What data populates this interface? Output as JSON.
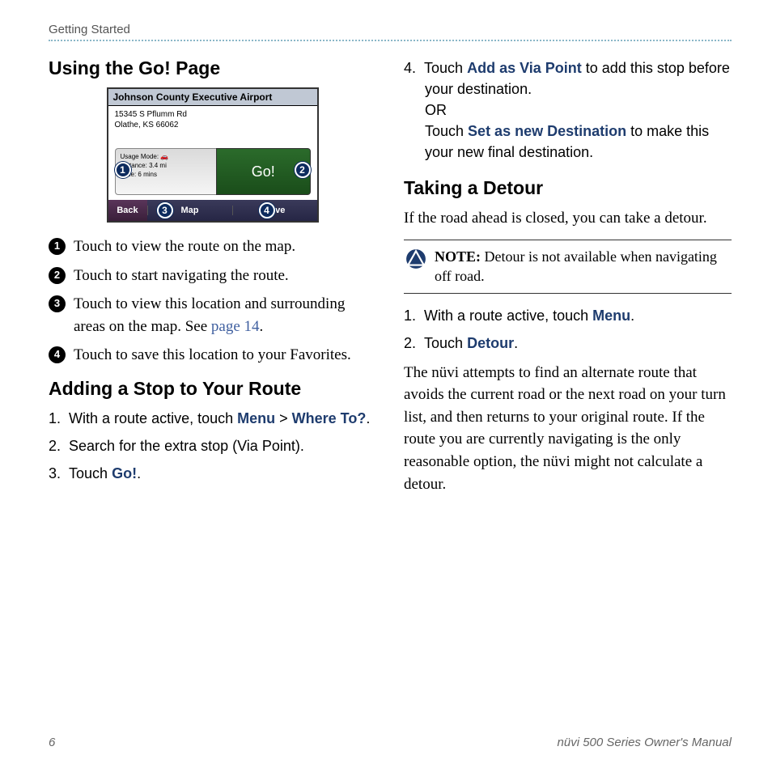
{
  "header": {
    "section": "Getting Started"
  },
  "left": {
    "h1": "Using the Go! Page",
    "device": {
      "title": "Johnson County Executive Airport",
      "addr1": "15345 S Pflumm Rd",
      "addr2": "Olathe, KS 66062",
      "info1": "Usage Mode: 🚗",
      "info2": "Distance: 3.4 mi",
      "info3": "Time: 6 mins",
      "go": "Go!",
      "back": "Back",
      "map": "Map",
      "save": "Save",
      "callouts": {
        "c1": "1",
        "c2": "2",
        "c3": "3",
        "c4": "4"
      }
    },
    "bullets": {
      "n1": "1",
      "t1": "Touch to view the route on the map.",
      "n2": "2",
      "t2": "Touch to start navigating the route.",
      "n3": "3",
      "t3a": "Touch to view this location and surrounding areas on the map. See ",
      "t3link": "page 14",
      "t3b": ".",
      "n4": "4",
      "t4": "Touch to save this location to your Favorites."
    },
    "h2": "Adding a Stop to Your Route",
    "steps": {
      "s1num": "1.",
      "s1a": "With a route active, touch ",
      "s1b": "Menu",
      "s1c": " > ",
      "s1d": "Where To?",
      "s1e": ".",
      "s2num": "2.",
      "s2": "Search for the extra stop (Via Point).",
      "s3num": "3.",
      "s3a": "Touch ",
      "s3b": "Go!",
      "s3c": "."
    }
  },
  "right": {
    "continuation": {
      "s4num": "4.",
      "s4a": "Touch ",
      "s4b": "Add as Via Point",
      "s4c": " to add this stop before your destination.",
      "or": "OR",
      "s4d": "Touch ",
      "s4e": "Set as new Destination",
      "s4f": " to make this your new final destination."
    },
    "h1": "Taking a Detour",
    "intro": "If the road ahead is closed, you can take a detour.",
    "note_label": "NOTE:",
    "note_body": " Detour is not available when navigating off road.",
    "steps": {
      "s1num": "1.",
      "s1a": "With a route active, touch ",
      "s1b": "Menu",
      "s1c": ".",
      "s2num": "2.",
      "s2a": "Touch ",
      "s2b": "Detour",
      "s2c": "."
    },
    "outro": "The nüvi attempts to find an alternate route that avoids the current road or the next road on your turn list, and then returns to your original route. If the route you are currently navigating is the only reasonable option, the nüvi might not calculate a detour."
  },
  "footer": {
    "page": "6",
    "title": "nüvi 500 Series Owner's Manual"
  }
}
